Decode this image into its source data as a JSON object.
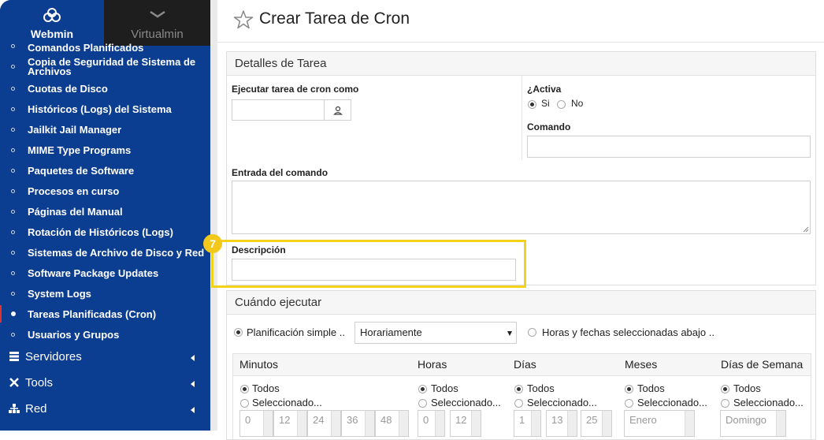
{
  "sidebar": {
    "tabs": [
      {
        "label": "Webmin",
        "icon": "webmin-logo-icon",
        "active": true
      },
      {
        "label": "Virtualmin",
        "icon": "chevron-down-icon",
        "active": false
      }
    ],
    "items": [
      {
        "label": "Comandos Planificados"
      },
      {
        "label": "Copia de Seguridad de Sistema de Archivos"
      },
      {
        "label": "Cuotas de Disco"
      },
      {
        "label": "Históricos (Logs) del Sistema"
      },
      {
        "label": "Jailkit Jail Manager"
      },
      {
        "label": "MIME Type Programs"
      },
      {
        "label": "Paquetes de Software"
      },
      {
        "label": "Procesos en curso"
      },
      {
        "label": "Páginas del Manual"
      },
      {
        "label": "Rotación de Históricos (Logs)"
      },
      {
        "label": "Sistemas de Archivo de Disco y Red"
      },
      {
        "label": "Software Package Updates"
      },
      {
        "label": "System Logs"
      },
      {
        "label": "Tareas Planificadas (Cron)",
        "active": true
      },
      {
        "label": "Usuarios y Grupos"
      }
    ],
    "categories": [
      {
        "label": "Servidores",
        "icon": "servers-icon"
      },
      {
        "label": "Tools",
        "icon": "tools-icon"
      },
      {
        "label": "Red",
        "icon": "network-icon"
      }
    ]
  },
  "header": {
    "title": "Crear Tarea de Cron",
    "icon": "star-icon"
  },
  "details": {
    "heading": "Detalles de Tarea",
    "run_as_label": "Ejecutar tarea de cron como",
    "run_as_value": "",
    "active_label": "¿Activa",
    "active_yes": "Si",
    "active_no": "No",
    "command_label": "Comando",
    "command_value": "",
    "input_label": "Entrada del comando",
    "input_value": "",
    "description_label": "Descripción",
    "description_value": ""
  },
  "when": {
    "heading": "Cuándo ejecutar",
    "simple_label": "Planificación simple ..",
    "simple_select": "Horariamente",
    "selected_label": "Horas y fechas seleccionadas abajo ..",
    "columns": [
      {
        "label": "Minutos",
        "all": "Todos",
        "selected": "Seleccionado...",
        "values": [
          "0",
          "12",
          "24",
          "36",
          "48"
        ]
      },
      {
        "label": "Horas",
        "all": "Todos",
        "selected": "Seleccionado...",
        "values": [
          "0",
          "12"
        ]
      },
      {
        "label": "Días",
        "all": "Todos",
        "selected": "Seleccionado...",
        "values": [
          "1",
          "13",
          "25"
        ]
      },
      {
        "label": "Meses",
        "all": "Todos",
        "selected": "Seleccionado...",
        "values": [
          "Enero"
        ]
      },
      {
        "label": "Días de Semana",
        "all": "Todos",
        "selected": "Seleccionado...",
        "values": [
          "Domingo"
        ]
      }
    ]
  },
  "annotation": {
    "step_number": "7",
    "color": "#f2d21b"
  },
  "colors": {
    "sidebar_bg": "#0b3d91",
    "accent_red": "#e0312d"
  }
}
